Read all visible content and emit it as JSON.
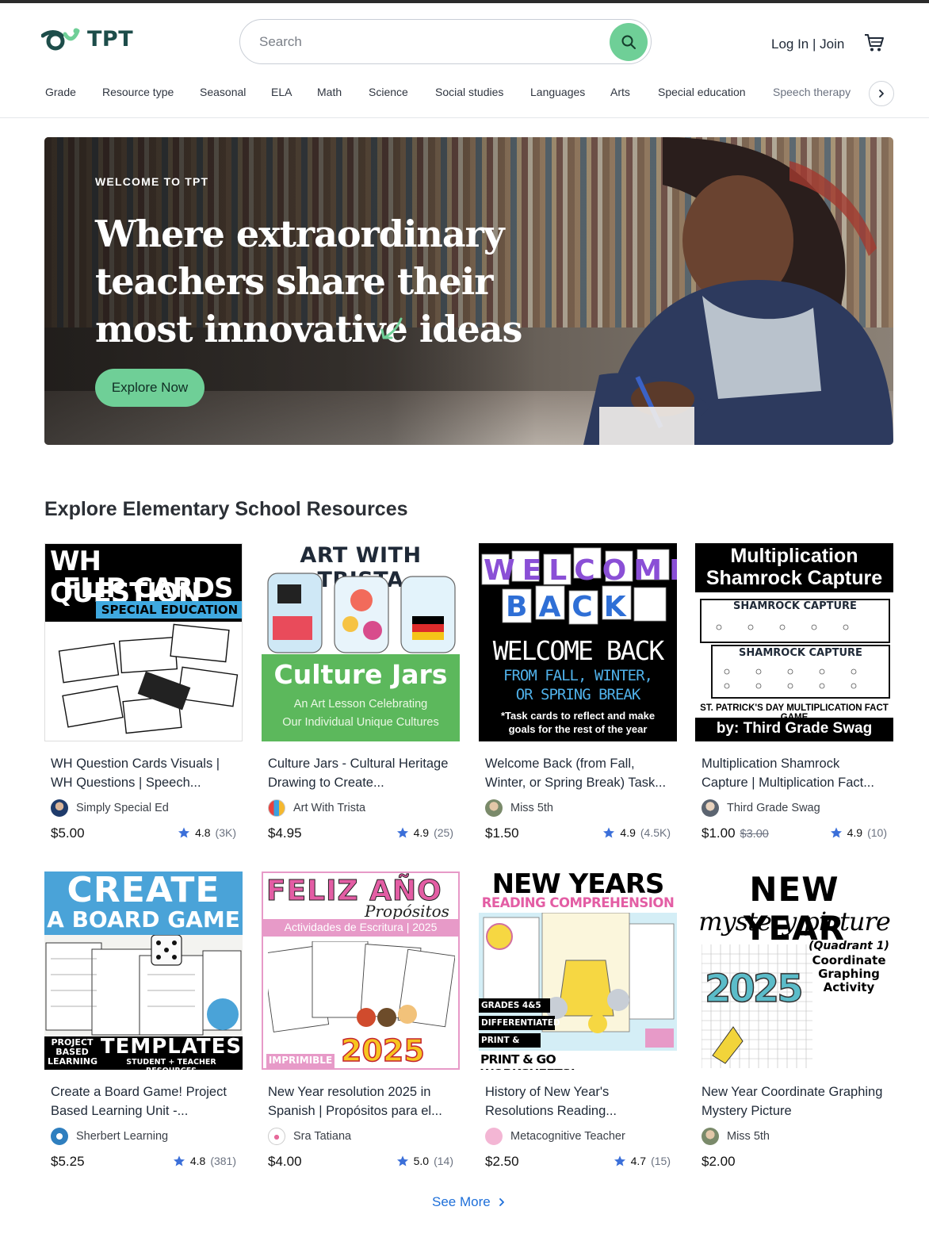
{
  "brand": {
    "name": "TPT"
  },
  "search": {
    "placeholder": "Search"
  },
  "header": {
    "login_label": "Log In | Join"
  },
  "categories": [
    "Grade",
    "Resource type",
    "Seasonal",
    "ELA",
    "Math",
    "Science",
    "Social studies",
    "Languages",
    "Arts",
    "Special education",
    "Speech therapy"
  ],
  "hero": {
    "kicker": "WELCOME TO TPT",
    "title": "Where extraordinary teachers share their most innovative ideas",
    "button_label": "Explore Now"
  },
  "section": {
    "title": "Explore Elementary School Resources"
  },
  "products": [
    {
      "title": "WH Question Cards Visuals | WH Questions | Speech...",
      "author": "Simply Special Ed",
      "price": "$5.00",
      "old_price": "",
      "rating": "4.8",
      "count": "(3K)",
      "thumb": {
        "line1": "WH QUESTION",
        "line2": "FLIP CARDS",
        "tag": "SPECIAL EDUCATION"
      }
    },
    {
      "title": "Culture Jars - Cultural Heritage Drawing to Create...",
      "author": "Art With Trista",
      "price": "$4.95",
      "old_price": "",
      "rating": "4.9",
      "count": "(25)",
      "thumb": {
        "header": "ART WITH TRISTA",
        "title": "Culture Jars",
        "sub1": "An Art Lesson Celebrating",
        "sub2": "Our Individual Unique Cultures"
      }
    },
    {
      "title": "Welcome Back (from Fall, Winter, or Spring Break) Task...",
      "author": "Miss 5th",
      "price": "$1.50",
      "old_price": "",
      "rating": "4.9",
      "count": "(4.5K)",
      "thumb": {
        "word1": "WELCOME",
        "word2": "BACK",
        "title": "WELCOME BACK",
        "sub1": "FROM FALL, WINTER,",
        "sub2": "OR SPRING BREAK",
        "note1": "*Task cards to reflect and make",
        "note2": "goals for the rest of the year"
      }
    },
    {
      "title": "Multiplication Shamrock Capture | Multiplication Fact...",
      "author": "Third Grade Swag",
      "price": "$1.00",
      "old_price": "$3.00",
      "rating": "4.9",
      "count": "(10)",
      "thumb": {
        "line1": "Multiplication",
        "line2": "Shamrock Capture",
        "game": "SHAMROCK CAPTURE",
        "footer": "ST. PATRICK'S DAY MULTIPLICATION FACT GAME",
        "by": "by: Third Grade Swag"
      }
    },
    {
      "title": "Create a Board Game! Project Based Learning Unit -...",
      "author": "Sherbert Learning",
      "price": "$5.25",
      "old_price": "",
      "rating": "4.8",
      "count": "(381)",
      "thumb": {
        "line1": "CREATE",
        "line2": "A BOARD GAME",
        "left": "PROJECT BASED LEARNING",
        "right": "TEMPLATES",
        "right_sub": "STUDENT + TEACHER RESOURCES"
      }
    },
    {
      "title": "New Year resolution 2025 in Spanish | Propósitos para el...",
      "author": "Sra Tatiana",
      "price": "$4.00",
      "old_price": "",
      "rating": "5.0",
      "count": "(14)",
      "thumb": {
        "line1": "FELIZ AÑO",
        "script": "Propósitos",
        "band": "Actividades de Escritura | 2025",
        "year": "2025",
        "tag": "IMPRIMIBLE"
      }
    },
    {
      "title": "History of New Year's Resolutions Reading...",
      "author": "Metacognitive Teacher",
      "price": "$2.50",
      "old_price": "",
      "rating": "4.7",
      "count": "(15)",
      "thumb": {
        "line1": "NEW YEARS",
        "line2": "READING COMPREHENSION",
        "tag1": "GRADES 4&5",
        "tag2": "DIFFERENTIATED",
        "tag3": "PRINT & EASEL",
        "footer": "PRINT & GO WORKSHEETS!"
      }
    },
    {
      "title": "New Year Coordinate Graphing Mystery Picture",
      "author": "Miss 5th",
      "price": "$2.00",
      "old_price": "",
      "rating": "",
      "count": "",
      "thumb": {
        "line1": "NEW YEAR",
        "line2": "mystery picture",
        "sub1": "(Quadrant 1)",
        "sub2": "Coordinate",
        "sub3": "Graphing",
        "sub4": "Activity",
        "year": "2025"
      }
    }
  ],
  "see_more": {
    "label": "See More"
  },
  "colors": {
    "accent": "#6fcf97",
    "link": "#1e6fd9",
    "star": "#3b6fd9",
    "brand": "#1d4d4a"
  },
  "icons": {
    "search": "search-icon",
    "cart": "cart-icon",
    "next": "chevron-right-icon",
    "star": "star-icon"
  }
}
